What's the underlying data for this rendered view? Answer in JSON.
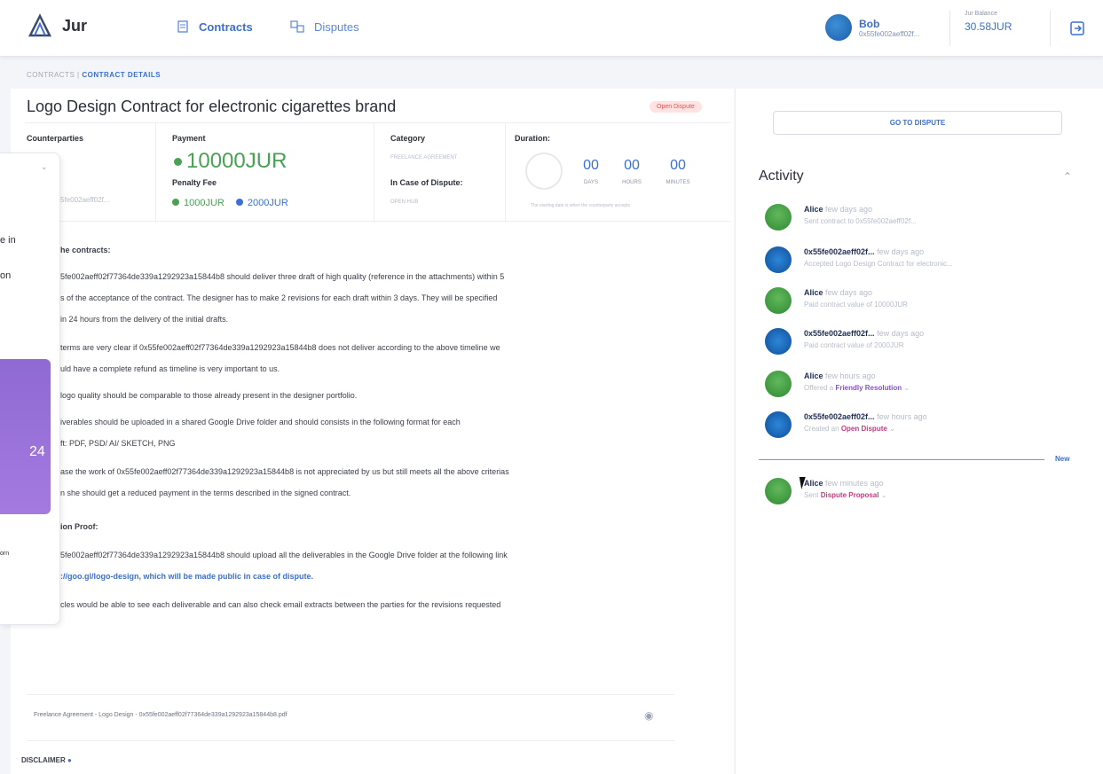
{
  "header": {
    "logo_text": "Jur",
    "nav_contracts": "Contracts",
    "nav_disputes": "Disputes",
    "user_name": "Bob",
    "user_address": "0x55fe002aeff02f...",
    "balance_label": "Jur Balance",
    "balance_value": "30.58JUR"
  },
  "breadcrumb": {
    "contracts": "CONTRACTS",
    "details": "CONTRACT DETAILS"
  },
  "contract": {
    "title": "Logo Design Contract for electronic cigarettes brand",
    "status_badge": "Open Dispute",
    "counterparties_label": "Counterparties",
    "counterparty_addr": "5fe002aeff02f...",
    "payment_label": "Payment",
    "payment_value": "10000JUR",
    "penalty_label": "Penalty Fee",
    "penalty_a": "1000JUR",
    "penalty_b": "2000JUR",
    "category_label": "Category",
    "category_value": "FREELANCE AGREEMENT",
    "dispute_label": "In Case of Dispute:",
    "dispute_value": "OPEN HUB",
    "duration_label": "Duration:",
    "days": "00",
    "hours": "00",
    "minutes": "00",
    "days_lbl": "DAYS",
    "hours_lbl": "HOURS",
    "minutes_lbl": "MINUTES",
    "duration_note": "The starting date is when the counterparty accepts"
  },
  "body": {
    "l1": "he contracts:",
    "l2": "5fe002aeff02f77364de339a1292923a15844b8 should deliver three draft of high quality (reference in the attachments) within 5",
    "l3": "s of the acceptance of the contract. The designer has to make 2 revisions for each draft within 3 days. They will be specified",
    "l4": "in 24 hours from the delivery of the initial drafts.",
    "l5": "terms are very clear if 0x55fe002aeff02f77364de339a1292923a15844b8 does not deliver according to the above timeline we",
    "l6": "uld have a complete refund as timeline is very important to us.",
    "l7": "logo quality should be comparable to those already present in the designer portfolio.",
    "l8": "iverables should be uploaded in a shared Google Drive folder and should consists in the following format for each",
    "l9": "ft: PDF, PSD/ AI/ SKETCH, PNG",
    "l10": "ase the work of 0x55fe002aeff02f77364de339a1292923a15844b8 is not appreciated by us but still meets all the above criterias",
    "l11": "n she should get a reduced payment in the terms described in the signed contract.",
    "l12": "ion Proof:",
    "l13": "5fe002aeff02f77364de339a1292923a15844b8 should upload all the deliverables in the Google Drive folder at the following link",
    "l14": "://goo.gl/logo-design, which will be made public in case of dispute.",
    "l15": "cles would be able to see each deliverable and can also check email extracts between the parties for the revisions requested"
  },
  "overlay": {
    "t1": "e in",
    "t2": "on",
    "t3": "24",
    "t4": "orn"
  },
  "file": "Freelance Agreement - Logo Design - 0x55fe002aeff02f77364de339a1292923a15844b8.pdf",
  "disclaimer": "DISCLAIMER",
  "right": {
    "go_dispute": "GO TO DISPUTE",
    "activity_title": "Activity",
    "new_label": "New",
    "items": [
      {
        "name": "Alice",
        "time": "few days ago",
        "desc": "Sent contract to  0x55fe002aeff02f..."
      },
      {
        "name": "0x55fe002aeff02f...",
        "time": "few days ago",
        "desc": "Accepted Logo Design Contract for electronic..."
      },
      {
        "name": "Alice",
        "time": "few days ago",
        "desc": "Paid contract value of 10000JUR"
      },
      {
        "name": "0x55fe002aeff02f...",
        "time": "few days ago",
        "desc": "Paid contract value of 2000JUR"
      },
      {
        "name": "Alice",
        "time": "few hours ago",
        "desc_pre": "Offered a ",
        "desc_hl": "Friendly Resolution"
      },
      {
        "name": "0x55fe002aeff02f...",
        "time": "few hours ago",
        "desc_pre": "Created an ",
        "desc_hl": "Open Dispute"
      },
      {
        "name": "Alice",
        "time": "few minutes ago",
        "desc_pre": "Sent ",
        "desc_hl": "Dispute Proposal"
      }
    ]
  },
  "colors": {
    "accent": "#3b6fd6",
    "green": "#4aa055",
    "purple": "#8a4fd0",
    "magenta": "#c23c7e",
    "badge_bg": "#ffe3e3",
    "badge_fg": "#e25454"
  }
}
